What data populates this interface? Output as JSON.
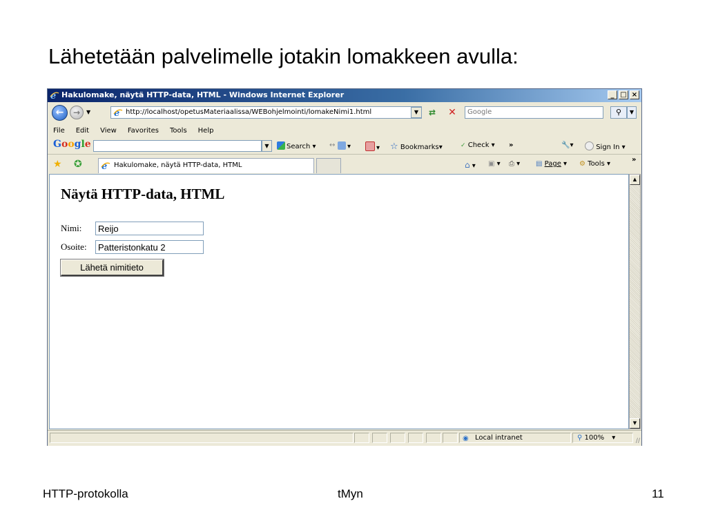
{
  "slide": {
    "title": "Lähetetään palvelimelle jotakin lomakkeen avulla:",
    "footer_left": "HTTP-protokolla",
    "footer_center": "tMyn",
    "footer_right": "11"
  },
  "window": {
    "title": "Hakulomake, näytä HTTP-data, HTML - Windows Internet Explorer",
    "btn_minimize": "_",
    "btn_maximize": "□",
    "btn_close": "×"
  },
  "address": {
    "url": "http://localhost/opetusMateriaalissa/WEBohjelmointi/lomakeNimi1.html"
  },
  "search": {
    "placeholder": "Google"
  },
  "menu": {
    "file": "File",
    "edit": "Edit",
    "view": "View",
    "favorites": "Favorites",
    "tools": "Tools",
    "help": "Help"
  },
  "googlebar": {
    "search": "Search",
    "bookmarks": "Bookmarks",
    "check": "Check",
    "more": "»",
    "sign_in": "Sign In"
  },
  "tab": {
    "title": "Hakulomake, näytä HTTP-data, HTML"
  },
  "commandbar": {
    "page": "Page",
    "tools": "Tools",
    "more": "»"
  },
  "page": {
    "heading": "Näytä HTTP-data, HTML",
    "name_label": "Nimi:",
    "name_value": "Reijo",
    "address_label": "Osoite:",
    "address_value": "Patteristonkatu 2",
    "submit_label": "Lähetä nimitieto"
  },
  "status": {
    "zone": "Local intranet",
    "zoom": "100%"
  },
  "colors": {
    "titlebar_start": "#0a246a",
    "titlebar_end": "#a6caf0",
    "chrome": "#ece9d8"
  }
}
